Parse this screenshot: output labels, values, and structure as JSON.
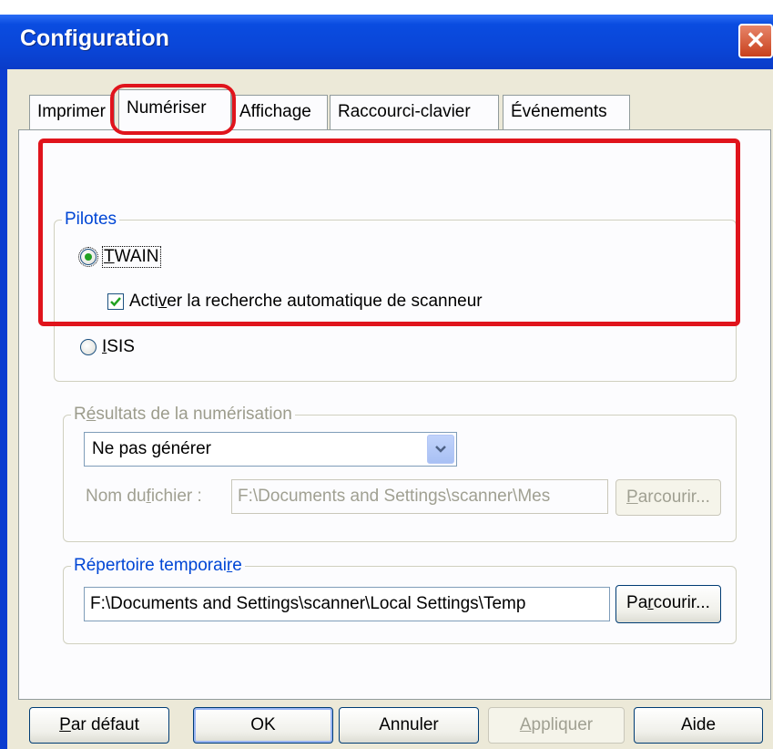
{
  "window": {
    "title": "Configuration",
    "close": "✕"
  },
  "tabs": [
    {
      "label": "Imprimer",
      "active": false
    },
    {
      "label": "Numériser",
      "active": true
    },
    {
      "label": "Affichage",
      "active": false
    },
    {
      "label": "Raccourci-clavier",
      "active": false
    },
    {
      "label": "Événements",
      "active": false
    }
  ],
  "pilotes": {
    "legend": "Pilotes",
    "twain": {
      "pre": "",
      "accel": "T",
      "post": "WAIN",
      "selected": true
    },
    "auto_search": {
      "pre": "Acti",
      "accel": "v",
      "post": "er la recherche automatique de scanneur",
      "checked": true
    },
    "isis": {
      "pre": "",
      "accel": "I",
      "post": "SIS",
      "selected": false
    }
  },
  "resultats": {
    "legend_pre": "R",
    "legend_accel": "é",
    "legend_post": "sultats de la numérisation",
    "select_value": "Ne pas générer",
    "file_label_pre": "Nom du ",
    "file_label_accel": "f",
    "file_label_post": "ichier :",
    "file_value": "F:\\Documents and Settings\\scanner\\Mes",
    "browse_pre": "",
    "browse_accel": "P",
    "browse_post": "arcourir..."
  },
  "temp": {
    "legend_pre": "Répertoire temporai",
    "legend_accel": "r",
    "legend_post": "e",
    "path_value": "F:\\Documents and Settings\\scanner\\Local Settings\\Temp",
    "browse_pre": "Pa",
    "browse_accel": "r",
    "browse_post": "courir..."
  },
  "buttons": {
    "default_pre": "",
    "default_accel": "P",
    "default_post": "ar défaut",
    "ok": "OK",
    "cancel": "Annuler",
    "apply_pre": "",
    "apply_accel": "A",
    "apply_post": "ppliquer",
    "help": "Aide"
  },
  "colors": {
    "highlight": "#e0141c",
    "titlebar": "#0a46d8",
    "dialog": "#ece9d8"
  }
}
